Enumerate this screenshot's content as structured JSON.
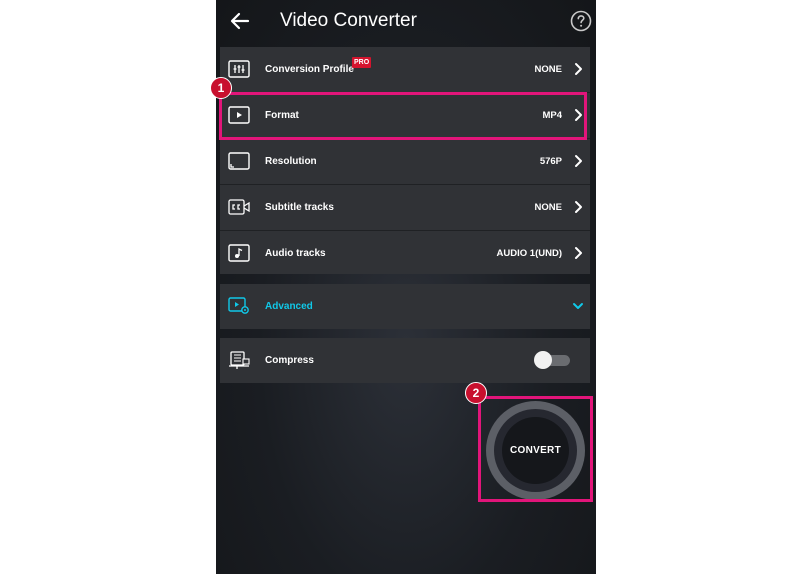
{
  "app": {
    "title": "Video Converter"
  },
  "rows": [
    {
      "label": "Conversion Profile",
      "value": "NONE",
      "badge": "PRO",
      "icon": "sliders-icon"
    },
    {
      "label": "Format",
      "value": "MP4",
      "icon": "play-box-icon"
    },
    {
      "label": "Resolution",
      "value": "576P",
      "icon": "screen-resolution-icon"
    },
    {
      "label": "Subtitle tracks",
      "value": "NONE",
      "icon": "closed-captions-icon"
    },
    {
      "label": "Audio tracks",
      "value": "AUDIO 1(UND)",
      "icon": "music-note-icon"
    }
  ],
  "advanced": {
    "label": "Advanced",
    "icon": "video-settings-icon",
    "accent": "#10c8e8"
  },
  "compress": {
    "label": "Compress",
    "icon": "compress-icon",
    "enabled": false
  },
  "convert": {
    "label": "CONVERT"
  },
  "annotations": {
    "step1": "1",
    "step2": "2",
    "highlight_color": "#e2157a",
    "step_color": "#c8102e"
  }
}
